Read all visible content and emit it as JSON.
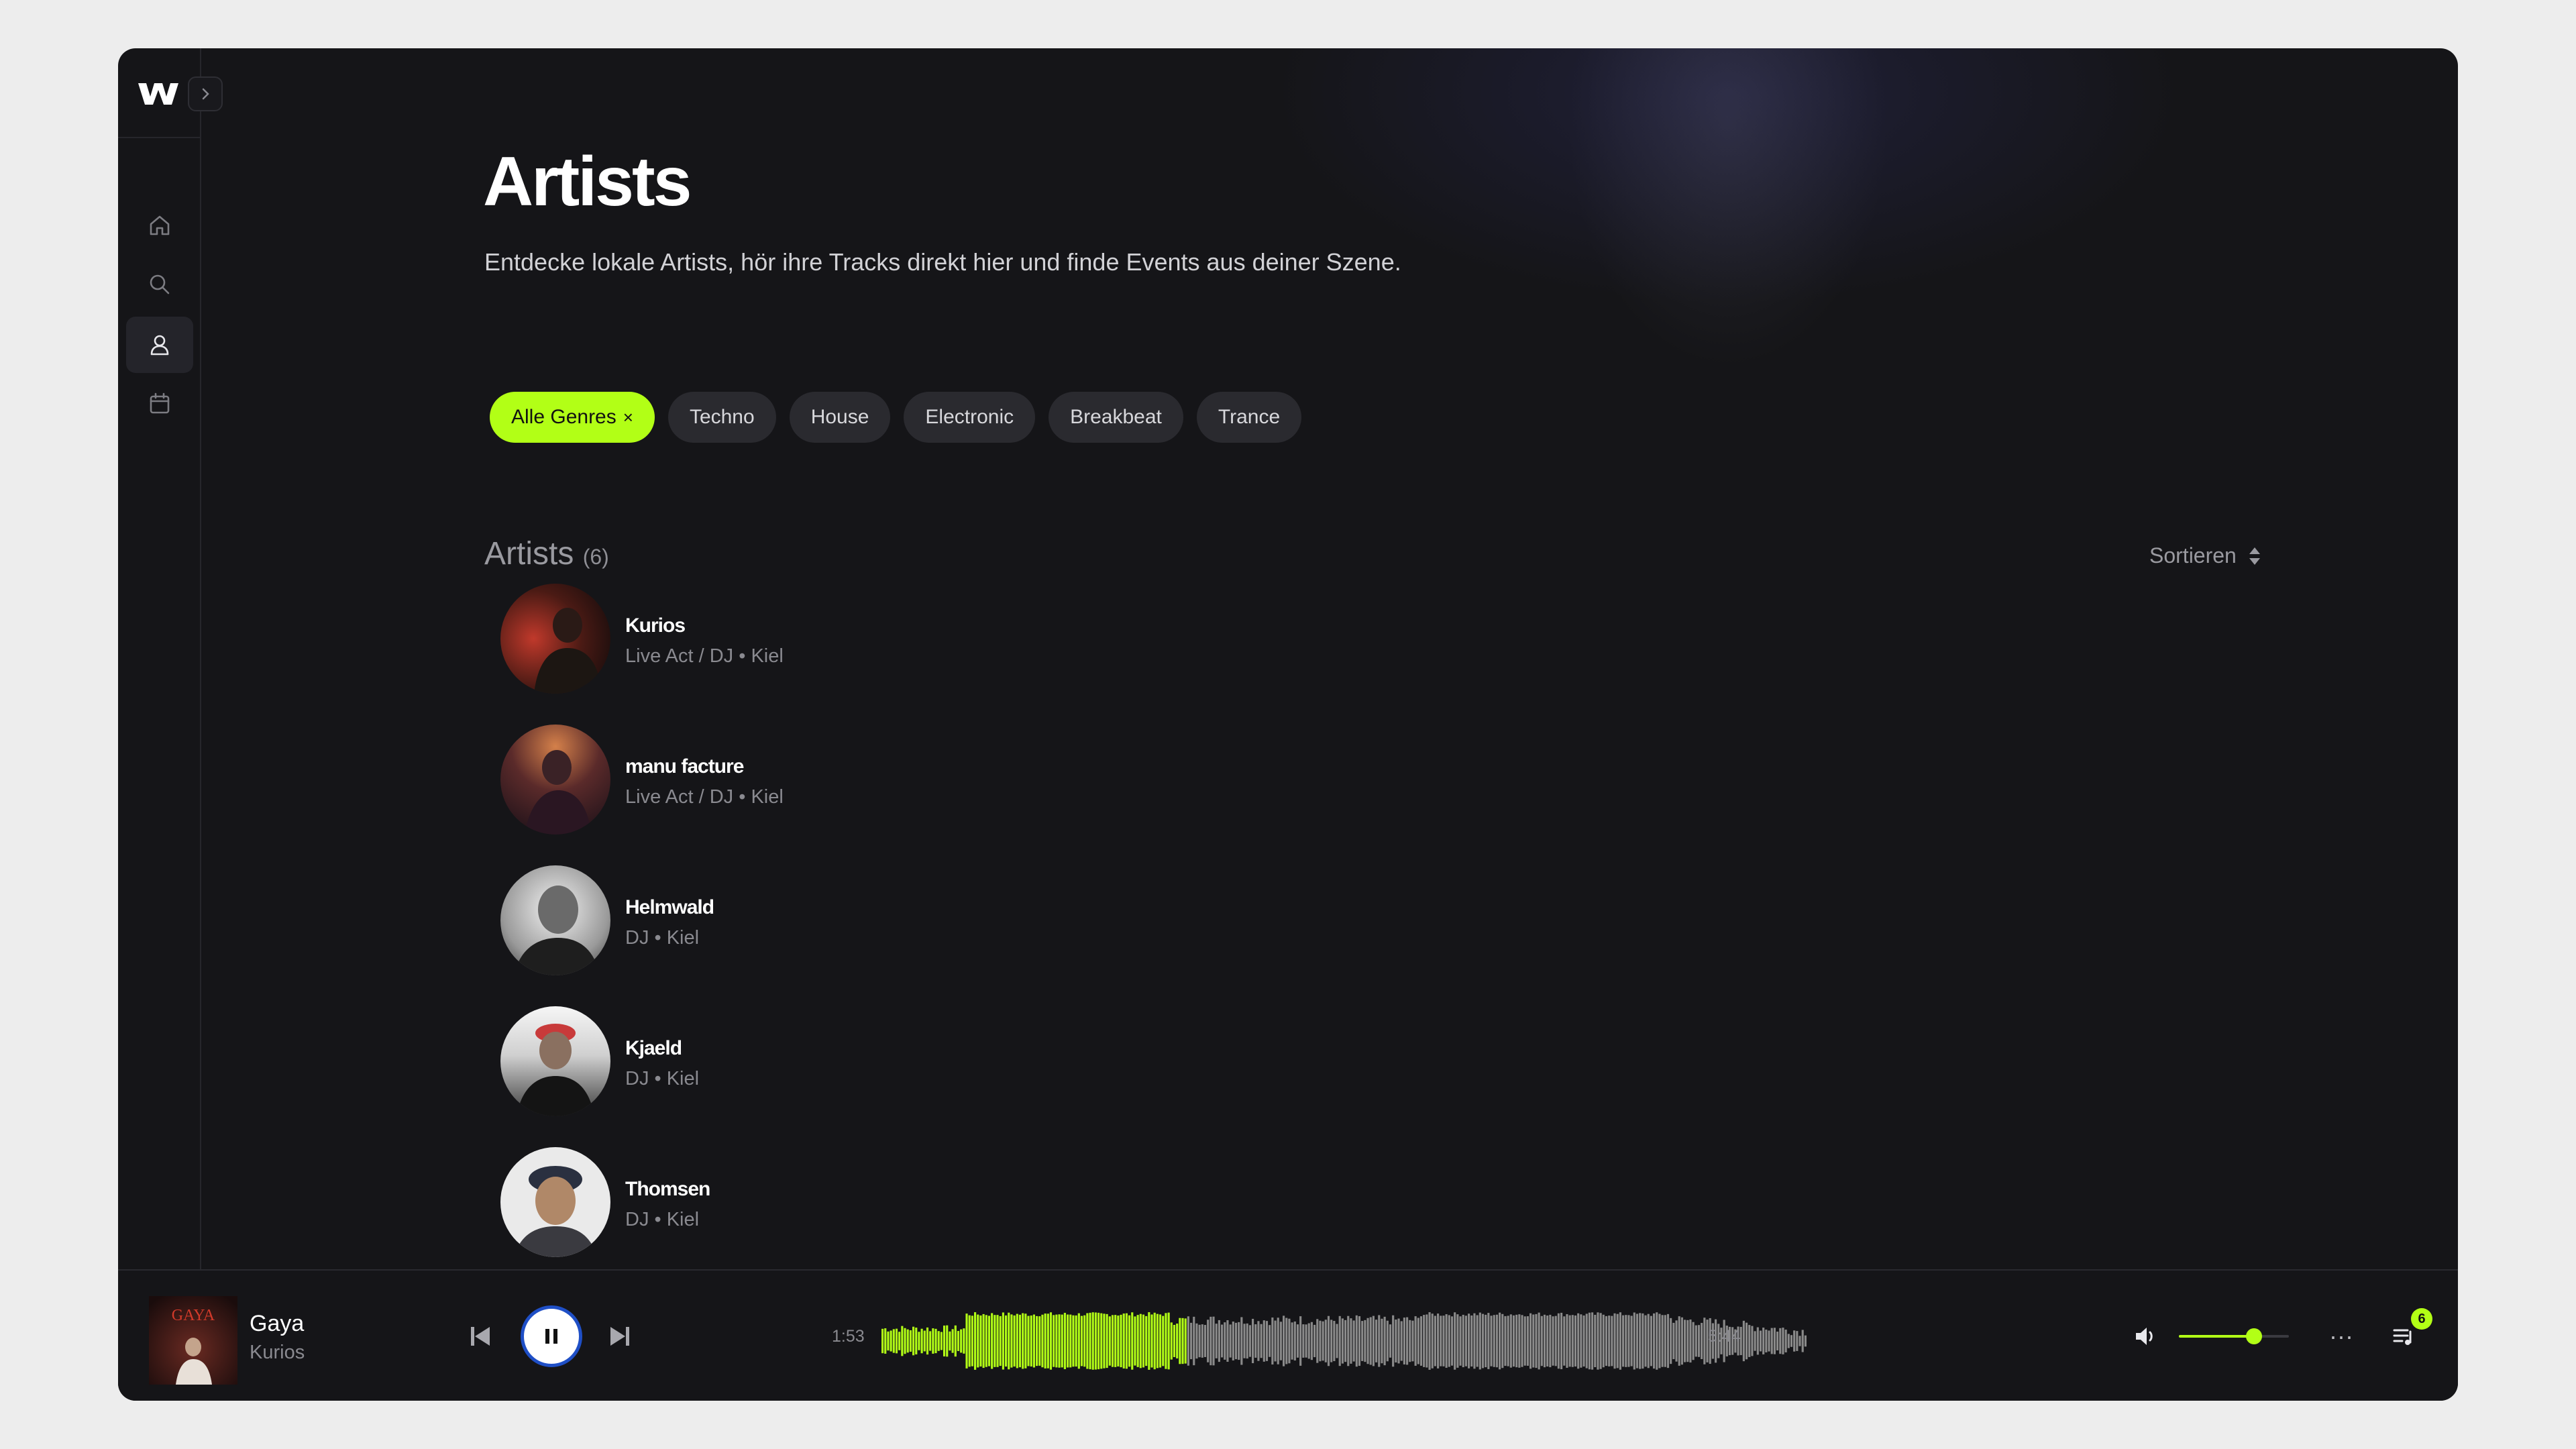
{
  "page": {
    "title": "Artists",
    "subtitle": "Entdecke lokale Artists, hör ihre Tracks direkt hier und finde Events aus deiner Szene."
  },
  "sidebar": {
    "items": [
      {
        "name": "home",
        "icon": "home-icon",
        "active": false
      },
      {
        "name": "search",
        "icon": "search-icon",
        "active": false
      },
      {
        "name": "artists",
        "icon": "user-icon",
        "active": true
      },
      {
        "name": "events",
        "icon": "calendar-icon",
        "active": false
      }
    ]
  },
  "filters": [
    {
      "label": "Alle Genres",
      "active": true,
      "close": "×"
    },
    {
      "label": "Techno",
      "active": false
    },
    {
      "label": "House",
      "active": false
    },
    {
      "label": "Electronic",
      "active": false
    },
    {
      "label": "Breakbeat",
      "active": false
    },
    {
      "label": "Trance",
      "active": false
    }
  ],
  "list": {
    "title": "Artists",
    "count": "(6)",
    "sort_label": "Sortieren"
  },
  "artists": [
    {
      "name": "Kurios",
      "meta": "Live Act / DJ • Kiel"
    },
    {
      "name": "manu facture",
      "meta": "Live Act / DJ • Kiel"
    },
    {
      "name": "Helmwald",
      "meta": "DJ • Kiel"
    },
    {
      "name": "Kjaeld",
      "meta": "DJ • Kiel"
    },
    {
      "name": "Thomsen",
      "meta": "DJ • Kiel"
    }
  ],
  "player": {
    "title": "Gaya",
    "artist": "Kurios",
    "cover_text": "GAYA",
    "elapsed": "1:53",
    "duration": "5:44",
    "progress": 0.33,
    "volume": 0.68,
    "queue_count": "6",
    "more_label": "···"
  },
  "colors": {
    "accent": "#b2ff16",
    "background": "#151518",
    "wave_idle": "#8a8a8a"
  }
}
